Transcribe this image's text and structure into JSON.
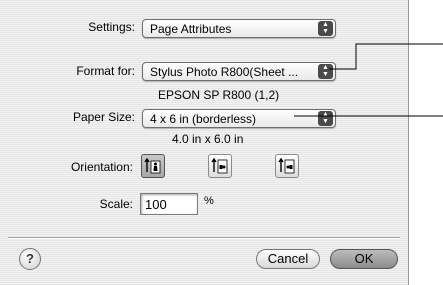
{
  "dialog": {
    "settings": {
      "label": "Settings:",
      "value": "Page Attributes"
    },
    "format_for": {
      "label": "Format for:",
      "value": "Stylus Photo R800(Sheet ...",
      "printer_info": "EPSON SP R800 (1,2)"
    },
    "paper_size": {
      "label": "Paper Size:",
      "value": "4 x 6 in (borderless)",
      "dimensions": "4.0 in x 6.0 in"
    },
    "orientation": {
      "label": "Orientation:",
      "options": [
        "portrait",
        "landscape-left",
        "landscape-right"
      ],
      "selected": "portrait"
    },
    "scale": {
      "label": "Scale:",
      "value": "100",
      "unit": "%"
    },
    "buttons": {
      "help": "?",
      "cancel": "Cancel",
      "ok": "OK"
    }
  }
}
